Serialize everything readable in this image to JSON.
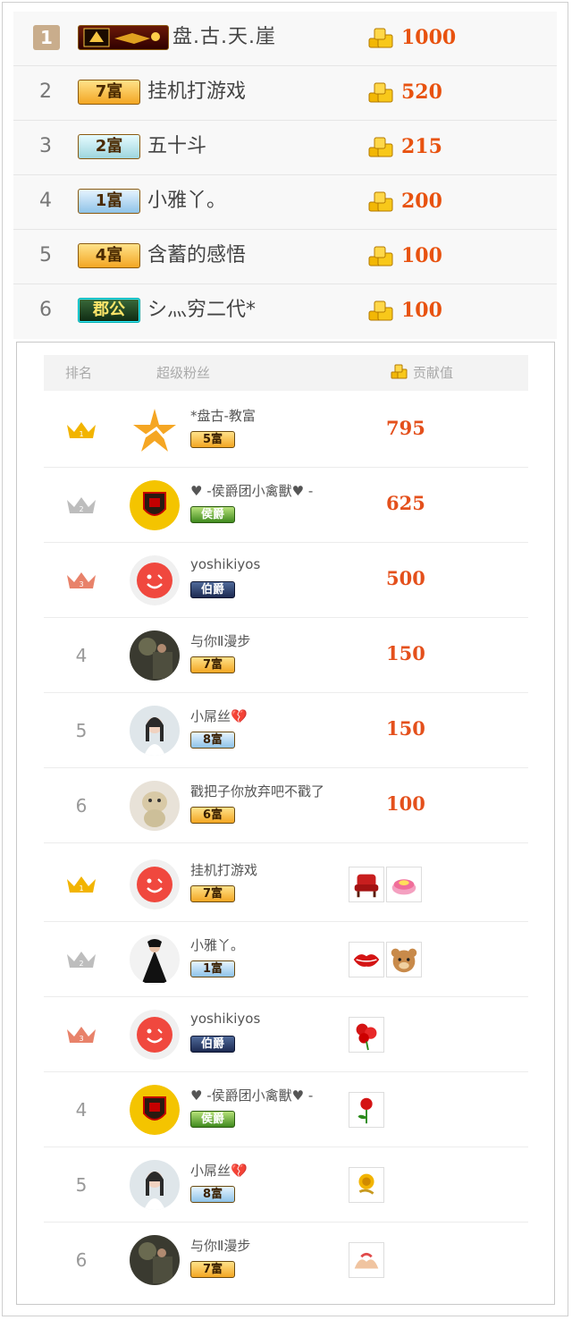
{
  "top_ranking": [
    {
      "rank": "1",
      "badge": "",
      "badge_style": "king",
      "name": "盘.古.天.崖",
      "amount": "1000"
    },
    {
      "rank": "2",
      "badge": "7富",
      "badge_style": "gold",
      "name": "挂机打游戏",
      "amount": "520"
    },
    {
      "rank": "3",
      "badge": "2富",
      "badge_style": "teal",
      "name": "五十斗",
      "amount": "215"
    },
    {
      "rank": "4",
      "badge": "1富",
      "badge_style": "blue",
      "name": "小雅丫。",
      "amount": "200"
    },
    {
      "rank": "5",
      "badge": "4富",
      "badge_style": "gold",
      "name": "含蓄的感悟",
      "amount": "100"
    },
    {
      "rank": "6",
      "badge": "郡公",
      "badge_style": "commandery",
      "name": "シ灬穷二代*",
      "amount": "100"
    }
  ],
  "fans_panel": {
    "header": {
      "rank": "排名",
      "fans": "超级粉丝",
      "contribution": "贡献值"
    },
    "contribution_rows": [
      {
        "rank": "1",
        "crown": "gold",
        "avatar": "star",
        "name": "*盘古-教富",
        "badge": "5富",
        "badge_style": "gold",
        "value": "795"
      },
      {
        "rank": "2",
        "crown": "silver",
        "avatar": "shield",
        "name": "♥ -侯爵团小禽獸♥ -",
        "badge": "侯爵",
        "badge_style": "green",
        "value": "625"
      },
      {
        "rank": "3",
        "crown": "bronze",
        "avatar": "red-face",
        "name": "yoshikiyos",
        "badge": "伯爵",
        "badge_style": "navy",
        "value": "500"
      },
      {
        "rank": "4",
        "crown": "",
        "avatar": "photo-dark",
        "name": "与你Ⅱ漫步",
        "badge": "7富",
        "badge_style": "gold",
        "value": "150"
      },
      {
        "rank": "5",
        "crown": "",
        "avatar": "photo-girl",
        "name": "小屌丝💔",
        "badge": "8富",
        "badge_style": "blue",
        "value": "150"
      },
      {
        "rank": "6",
        "crown": "",
        "avatar": "photo-toy",
        "name": "戳把子你放弃吧不戳了",
        "badge": "6富",
        "badge_style": "gold",
        "value": "100"
      }
    ],
    "gift_rows": [
      {
        "rank": "1",
        "crown": "gold",
        "avatar": "red-face",
        "name": "挂机打游戏",
        "badge": "7富",
        "badge_style": "gold",
        "gifts": [
          "chair-gift-icon",
          "cake-gift-icon"
        ]
      },
      {
        "rank": "2",
        "crown": "silver",
        "avatar": "photo-dress",
        "name": "小雅丫。",
        "badge": "1富",
        "badge_style": "blue",
        "gifts": [
          "lips-gift-icon",
          "bear-gift-icon"
        ]
      },
      {
        "rank": "3",
        "crown": "bronze",
        "avatar": "red-face",
        "name": "yoshikiyos",
        "badge": "伯爵",
        "badge_style": "navy",
        "gifts": [
          "roses-gift-icon"
        ]
      },
      {
        "rank": "4",
        "crown": "",
        "avatar": "shield",
        "name": "♥ -侯爵团小禽獸♥ -",
        "badge": "侯爵",
        "badge_style": "green",
        "gifts": [
          "rose-gift-icon"
        ]
      },
      {
        "rank": "5",
        "crown": "",
        "avatar": "photo-girl",
        "name": "小屌丝💔",
        "badge": "8富",
        "badge_style": "blue",
        "gifts": [
          "gold-rose-gift-icon"
        ]
      },
      {
        "rank": "6",
        "crown": "",
        "avatar": "photo-dark",
        "name": "与你Ⅱ漫步",
        "badge": "7富",
        "badge_style": "gold",
        "gifts": [
          "hands-gift-icon"
        ]
      }
    ]
  },
  "colors": {
    "amount": "#e8520f",
    "value": "#e4501c",
    "crown_gold": "#f2b400",
    "crown_silver": "#bdbdbd",
    "crown_bronze": "#e8826a"
  }
}
